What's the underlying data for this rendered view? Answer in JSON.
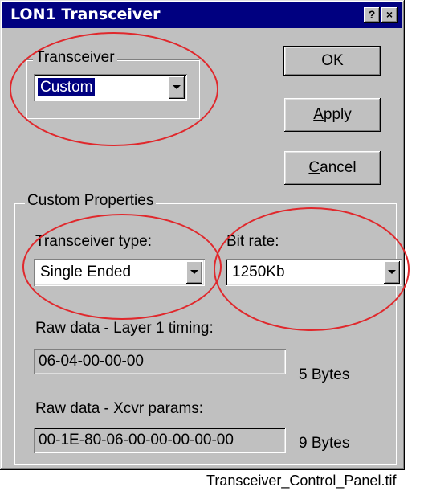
{
  "window": {
    "title": "LON1 Transceiver",
    "help_glyph": "?",
    "close_glyph": "×"
  },
  "transceiver_group": {
    "legend": "Transceiver",
    "selected": "Custom"
  },
  "buttons": {
    "ok": "OK",
    "apply": {
      "mnemonic": "A",
      "rest": "pply"
    },
    "cancel": {
      "mnemonic": "C",
      "rest": "ancel"
    }
  },
  "custom_properties": {
    "legend": "Custom Properties",
    "transceiver_type": {
      "label": "Transceiver type:",
      "value": "Single Ended"
    },
    "bit_rate": {
      "label": "Bit rate:",
      "value": "1250Kb"
    },
    "layer1_timing": {
      "label": "Raw data - Layer 1 timing:",
      "value": "06-04-00-00-00",
      "size": "5 Bytes"
    },
    "xcvr_params": {
      "label": "Raw data - Xcvr params:",
      "value": "00-1E-80-06-00-00-00-00-00",
      "size": "9 Bytes"
    }
  },
  "annotations": {
    "highlight_color": "#e0282c"
  },
  "caption": "Transceiver_Control_Panel.tif"
}
